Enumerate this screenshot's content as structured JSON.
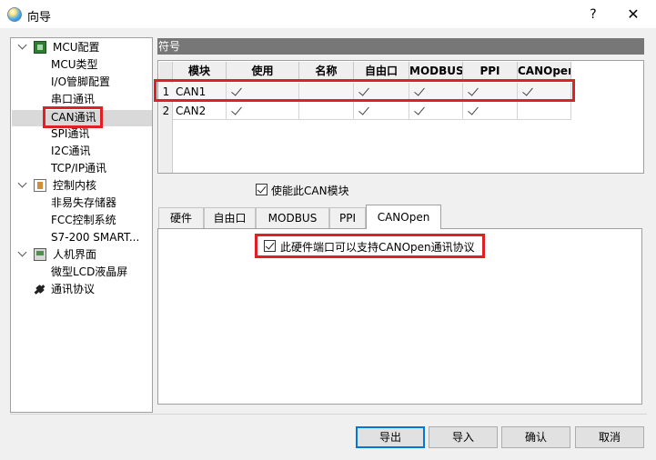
{
  "window": {
    "title": "向导",
    "help": "?",
    "close": "✕"
  },
  "tree": {
    "items": [
      {
        "label": "MCU配置",
        "icon": "chip-icon"
      },
      {
        "label": "MCU类型"
      },
      {
        "label": "I/O管脚配置"
      },
      {
        "label": "串口通讯"
      },
      {
        "label": "CAN通讯"
      },
      {
        "label": "SPI通讯"
      },
      {
        "label": "I2C通讯"
      },
      {
        "label": "TCP/IP通讯"
      },
      {
        "label": "控制内核",
        "icon": "kernel-icon"
      },
      {
        "label": "非易失存储器"
      },
      {
        "label": "FCC控制系统"
      },
      {
        "label": "S7-200 SMART..."
      },
      {
        "label": "人机界面",
        "icon": "hmi-icon"
      },
      {
        "label": "微型LCD液晶屏"
      },
      {
        "label": "通讯协议",
        "icon": "plug-icon"
      }
    ],
    "selected": "CAN通讯"
  },
  "symbol_panel": {
    "header": "符号",
    "columns": [
      "模块",
      "使用",
      "名称",
      "自由口",
      "MODBUS",
      "PPI",
      "CANOpen"
    ],
    "rows": [
      {
        "num": "1",
        "module": "CAN1",
        "use": true,
        "name": "",
        "free_port": true,
        "modbus": true,
        "ppi": true,
        "canopen": true
      },
      {
        "num": "2",
        "module": "CAN2",
        "use": true,
        "name": "",
        "free_port": true,
        "modbus": true,
        "ppi": true,
        "canopen": false
      }
    ]
  },
  "enable_can": {
    "label": "使能此CAN模块",
    "checked": true
  },
  "tabs": [
    {
      "label": "硬件"
    },
    {
      "label": "自由口"
    },
    {
      "label": "MODBUS"
    },
    {
      "label": "PPI"
    },
    {
      "label": "CANOpen",
      "active": true
    }
  ],
  "canopen_tab": {
    "support_label": "此硬件端口可以支持CANOpen通讯协议",
    "checked": true
  },
  "buttons": {
    "export": "导出",
    "import": "导入",
    "ok": "确认",
    "cancel": "取消"
  },
  "colors": {
    "highlight_red": "#e01f26",
    "accent_blue": "#0078d7",
    "header_gray": "#777777"
  }
}
